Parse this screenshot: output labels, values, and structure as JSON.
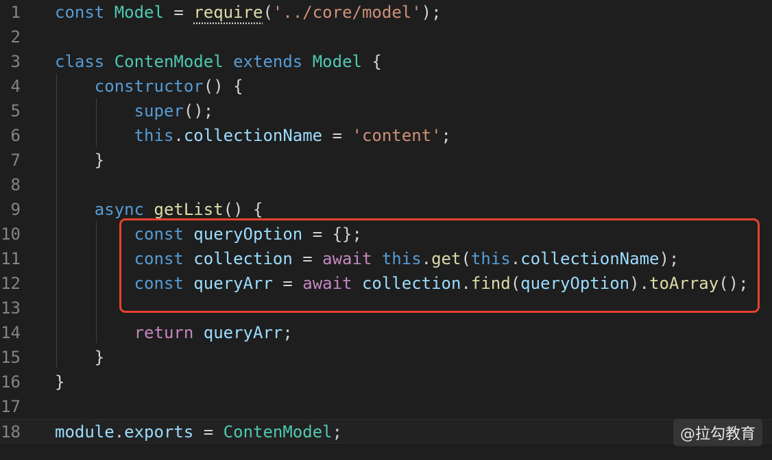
{
  "editor": {
    "lines": [
      {
        "number": "1",
        "tokens": [
          {
            "t": "const",
            "c": "kw"
          },
          {
            "t": " ",
            "c": "plain"
          },
          {
            "t": "Model",
            "c": "cls"
          },
          {
            "t": " = ",
            "c": "plain"
          },
          {
            "t": "require",
            "c": "fn",
            "dotted": true
          },
          {
            "t": "(",
            "c": "plain"
          },
          {
            "t": "'../core/model'",
            "c": "str"
          },
          {
            "t": ");",
            "c": "plain"
          }
        ]
      },
      {
        "number": "2",
        "tokens": []
      },
      {
        "number": "3",
        "tokens": [
          {
            "t": "class",
            "c": "kw"
          },
          {
            "t": " ",
            "c": "plain"
          },
          {
            "t": "ContenModel",
            "c": "cls"
          },
          {
            "t": " ",
            "c": "plain"
          },
          {
            "t": "extends",
            "c": "kw"
          },
          {
            "t": " ",
            "c": "plain"
          },
          {
            "t": "Model",
            "c": "cls"
          },
          {
            "t": " {",
            "c": "plain"
          }
        ]
      },
      {
        "number": "4",
        "tokens": [
          {
            "t": "    ",
            "c": "plain"
          },
          {
            "t": "constructor",
            "c": "kw"
          },
          {
            "t": "() {",
            "c": "plain"
          }
        ]
      },
      {
        "number": "5",
        "tokens": [
          {
            "t": "        ",
            "c": "plain"
          },
          {
            "t": "super",
            "c": "kw"
          },
          {
            "t": "();",
            "c": "plain"
          }
        ]
      },
      {
        "number": "6",
        "tokens": [
          {
            "t": "        ",
            "c": "plain"
          },
          {
            "t": "this",
            "c": "kw"
          },
          {
            "t": ".",
            "c": "plain"
          },
          {
            "t": "collectionName",
            "c": "var"
          },
          {
            "t": " = ",
            "c": "plain"
          },
          {
            "t": "'content'",
            "c": "str"
          },
          {
            "t": ";",
            "c": "plain"
          }
        ]
      },
      {
        "number": "7",
        "tokens": [
          {
            "t": "    }",
            "c": "plain"
          }
        ]
      },
      {
        "number": "8",
        "tokens": []
      },
      {
        "number": "9",
        "tokens": [
          {
            "t": "    ",
            "c": "plain"
          },
          {
            "t": "async",
            "c": "kw"
          },
          {
            "t": " ",
            "c": "plain"
          },
          {
            "t": "getList",
            "c": "fn"
          },
          {
            "t": "() {",
            "c": "plain"
          }
        ]
      },
      {
        "number": "10",
        "tokens": [
          {
            "t": "        ",
            "c": "plain"
          },
          {
            "t": "const",
            "c": "kw"
          },
          {
            "t": " ",
            "c": "plain"
          },
          {
            "t": "queryOption",
            "c": "var"
          },
          {
            "t": " = {};",
            "c": "plain"
          }
        ]
      },
      {
        "number": "11",
        "tokens": [
          {
            "t": "        ",
            "c": "plain"
          },
          {
            "t": "const",
            "c": "kw"
          },
          {
            "t": " ",
            "c": "plain"
          },
          {
            "t": "collection",
            "c": "var"
          },
          {
            "t": " = ",
            "c": "plain"
          },
          {
            "t": "await",
            "c": "ctrl"
          },
          {
            "t": " ",
            "c": "plain"
          },
          {
            "t": "this",
            "c": "kw"
          },
          {
            "t": ".",
            "c": "plain"
          },
          {
            "t": "get",
            "c": "fn"
          },
          {
            "t": "(",
            "c": "plain"
          },
          {
            "t": "this",
            "c": "kw"
          },
          {
            "t": ".",
            "c": "plain"
          },
          {
            "t": "collectionName",
            "c": "var"
          },
          {
            "t": ");",
            "c": "plain"
          }
        ]
      },
      {
        "number": "12",
        "tokens": [
          {
            "t": "        ",
            "c": "plain"
          },
          {
            "t": "const",
            "c": "kw"
          },
          {
            "t": " ",
            "c": "plain"
          },
          {
            "t": "queryArr",
            "c": "var"
          },
          {
            "t": " = ",
            "c": "plain"
          },
          {
            "t": "await",
            "c": "ctrl"
          },
          {
            "t": " ",
            "c": "plain"
          },
          {
            "t": "collection",
            "c": "var"
          },
          {
            "t": ".",
            "c": "plain"
          },
          {
            "t": "find",
            "c": "fn"
          },
          {
            "t": "(",
            "c": "plain"
          },
          {
            "t": "queryOption",
            "c": "var"
          },
          {
            "t": ").",
            "c": "plain"
          },
          {
            "t": "toArray",
            "c": "fn"
          },
          {
            "t": "();",
            "c": "plain"
          }
        ]
      },
      {
        "number": "13",
        "tokens": []
      },
      {
        "number": "14",
        "tokens": [
          {
            "t": "        ",
            "c": "plain"
          },
          {
            "t": "return",
            "c": "ctrl"
          },
          {
            "t": " ",
            "c": "plain"
          },
          {
            "t": "queryArr",
            "c": "var"
          },
          {
            "t": ";",
            "c": "plain"
          }
        ]
      },
      {
        "number": "15",
        "tokens": [
          {
            "t": "    }",
            "c": "plain"
          }
        ]
      },
      {
        "number": "16",
        "tokens": [
          {
            "t": "}",
            "c": "plain"
          }
        ]
      },
      {
        "number": "17",
        "tokens": []
      },
      {
        "number": "18",
        "current": true,
        "tokens": [
          {
            "t": "module",
            "c": "var"
          },
          {
            "t": ".",
            "c": "plain"
          },
          {
            "t": "exports",
            "c": "var"
          },
          {
            "t": " = ",
            "c": "plain"
          },
          {
            "t": "ContenModel",
            "c": "cls"
          },
          {
            "t": ";",
            "c": "plain"
          }
        ]
      }
    ]
  },
  "watermark": {
    "text": "@拉勾教育"
  },
  "colors": {
    "background": "#1e1e1e",
    "line_number": "#858585",
    "keyword": "#569cd6",
    "control_keyword": "#c586c0",
    "class_name": "#4ec9b0",
    "function_name": "#dcdcaa",
    "variable": "#9cdcfe",
    "string": "#ce9178",
    "punctuation": "#d4d4d4",
    "annotation_box": "#e8422f"
  }
}
